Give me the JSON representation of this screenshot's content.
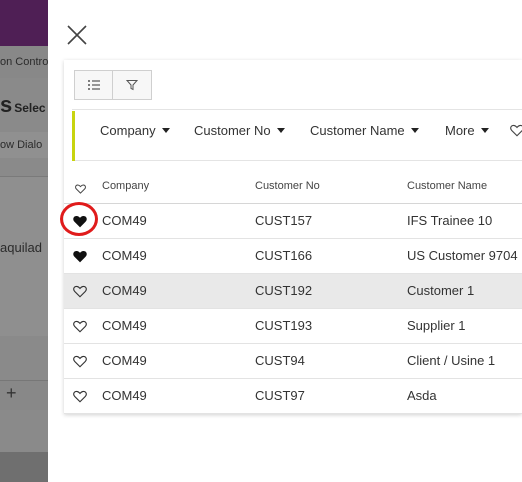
{
  "background": {
    "nav_text": "on Contro",
    "title_letter": "s",
    "title_suffix": "Selec",
    "dialog_bar_text": "ow Dialo",
    "panel_text": "aquilad"
  },
  "toolbar": {
    "list_icon": "list-icon",
    "filter_icon": "filter-icon"
  },
  "filters": [
    {
      "label": "Company"
    },
    {
      "label": "Customer No"
    },
    {
      "label": "Customer Name"
    },
    {
      "label": "More"
    }
  ],
  "columns": {
    "favorite_icon": "heart-outline-icon",
    "company": "Company",
    "customer_no": "Customer No",
    "customer_name": "Customer Name"
  },
  "rows": [
    {
      "favorite": true,
      "company": "COM49",
      "customer_no": "CUST157",
      "customer_name": "IFS Trainee 10"
    },
    {
      "favorite": true,
      "company": "COM49",
      "customer_no": "CUST166",
      "customer_name": "US Customer 9704"
    },
    {
      "favorite": false,
      "company": "COM49",
      "customer_no": "CUST192",
      "customer_name": "Customer 1"
    },
    {
      "favorite": false,
      "company": "COM49",
      "customer_no": "CUST193",
      "customer_name": "Supplier 1"
    },
    {
      "favorite": false,
      "company": "COM49",
      "customer_no": "CUST94",
      "customer_name": "Client / Usine 1"
    },
    {
      "favorite": false,
      "company": "COM49",
      "customer_no": "CUST97",
      "customer_name": "Asda"
    }
  ],
  "colors": {
    "accent": "#c8d40f",
    "highlight_circle": "#e01b1b",
    "app_header": "#4f1f55"
  }
}
